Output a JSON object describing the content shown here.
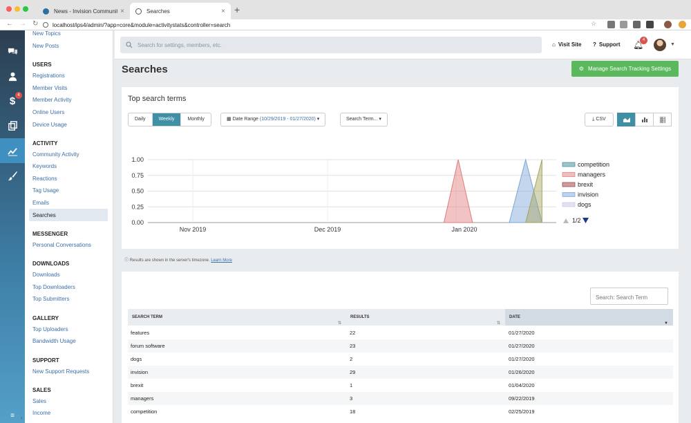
{
  "browser": {
    "tabs": [
      {
        "title": "News - Invision Community",
        "active": false
      },
      {
        "title": "Searches",
        "active": true
      }
    ],
    "url": "localhost/ips4/admin/?app=core&module=activitystats&controller=search"
  },
  "iconbar": {
    "badge": "4"
  },
  "sidebar": {
    "partial_items": [
      "New Topics",
      "New Posts"
    ],
    "sections": [
      {
        "title": "USERS",
        "items": [
          "Registrations",
          "Member Visits",
          "Member Activity",
          "Online Users",
          "Device Usage"
        ]
      },
      {
        "title": "ACTIVITY",
        "items": [
          "Community Activity",
          "Keywords",
          "Reactions",
          "Tag Usage",
          "Emails",
          "Searches"
        ]
      },
      {
        "title": "MESSENGER",
        "items": [
          "Personal Conversations"
        ]
      },
      {
        "title": "DOWNLOADS",
        "items": [
          "Downloads",
          "Top Downloaders",
          "Top Submitters"
        ]
      },
      {
        "title": "GALLERY",
        "items": [
          "Top Uploaders",
          "Bandwidth Usage"
        ]
      },
      {
        "title": "SUPPORT",
        "items": [
          "New Support Requests"
        ]
      },
      {
        "title": "SALES",
        "items": [
          "Sales",
          "Income"
        ]
      }
    ],
    "selected": "Searches"
  },
  "topbar": {
    "search_placeholder": "Search for settings, members, etc.",
    "visit_site": "Visit Site",
    "support": "Support",
    "notification_count": "4"
  },
  "page": {
    "title": "Searches",
    "manage_button": "Manage Search Tracking Settings",
    "timezone_note": "Results are shown in the server's timezone.",
    "learn_more": "Learn More"
  },
  "chart_panel": {
    "title": "Top search terms",
    "period_buttons": [
      "Daily",
      "Weekly",
      "Monthly"
    ],
    "active_period": "Weekly",
    "date_range_label": "Date Range",
    "date_range_value": "(10/29/2019 - 01/27/2020)",
    "search_term_button": "Search Term...",
    "csv_button": "CSV"
  },
  "chart_data": {
    "type": "area",
    "x_tick_labels": [
      "Nov 2019",
      "Dec 2019",
      "Jan 2020"
    ],
    "y_ticks": [
      "0.00",
      "0.25",
      "0.50",
      "0.75",
      "1.00"
    ],
    "ylim": [
      0,
      1
    ],
    "grid": true,
    "legend_position": "right",
    "legend_page": "1/2",
    "series": [
      {
        "name": "competition",
        "color": "#3d8a96",
        "points": []
      },
      {
        "name": "managers",
        "color": "#e07b7b",
        "points": [
          [
            0.725,
            0
          ],
          [
            0.76,
            1
          ],
          [
            0.795,
            0
          ]
        ]
      },
      {
        "name": "brexit",
        "color": "#9a3c3c",
        "points": []
      },
      {
        "name": "invision",
        "color": "#7ba4d8",
        "points": [
          [
            0.885,
            0
          ],
          [
            0.925,
            1
          ],
          [
            0.965,
            0
          ]
        ]
      },
      {
        "name": "dogs",
        "color": "#c9c4e6",
        "points": []
      },
      {
        "name": "forum software",
        "color": "#a3a35a",
        "points": [
          [
            0.925,
            0
          ],
          [
            0.965,
            1
          ],
          [
            0.965,
            0
          ]
        ]
      }
    ]
  },
  "table": {
    "search_placeholder": "Search: Search Term",
    "columns": [
      "SEARCH TERM",
      "RESULTS",
      "DATE"
    ],
    "sorted_column": "DATE",
    "rows": [
      [
        "features",
        "22",
        "01/27/2020"
      ],
      [
        "forum software",
        "23",
        "01/27/2020"
      ],
      [
        "dogs",
        "2",
        "01/27/2020"
      ],
      [
        "invision",
        "29",
        "01/26/2020"
      ],
      [
        "brexit",
        "1",
        "01/04/2020"
      ],
      [
        "managers",
        "3",
        "09/22/2019"
      ],
      [
        "competition",
        "18",
        "02/25/2019"
      ]
    ]
  }
}
